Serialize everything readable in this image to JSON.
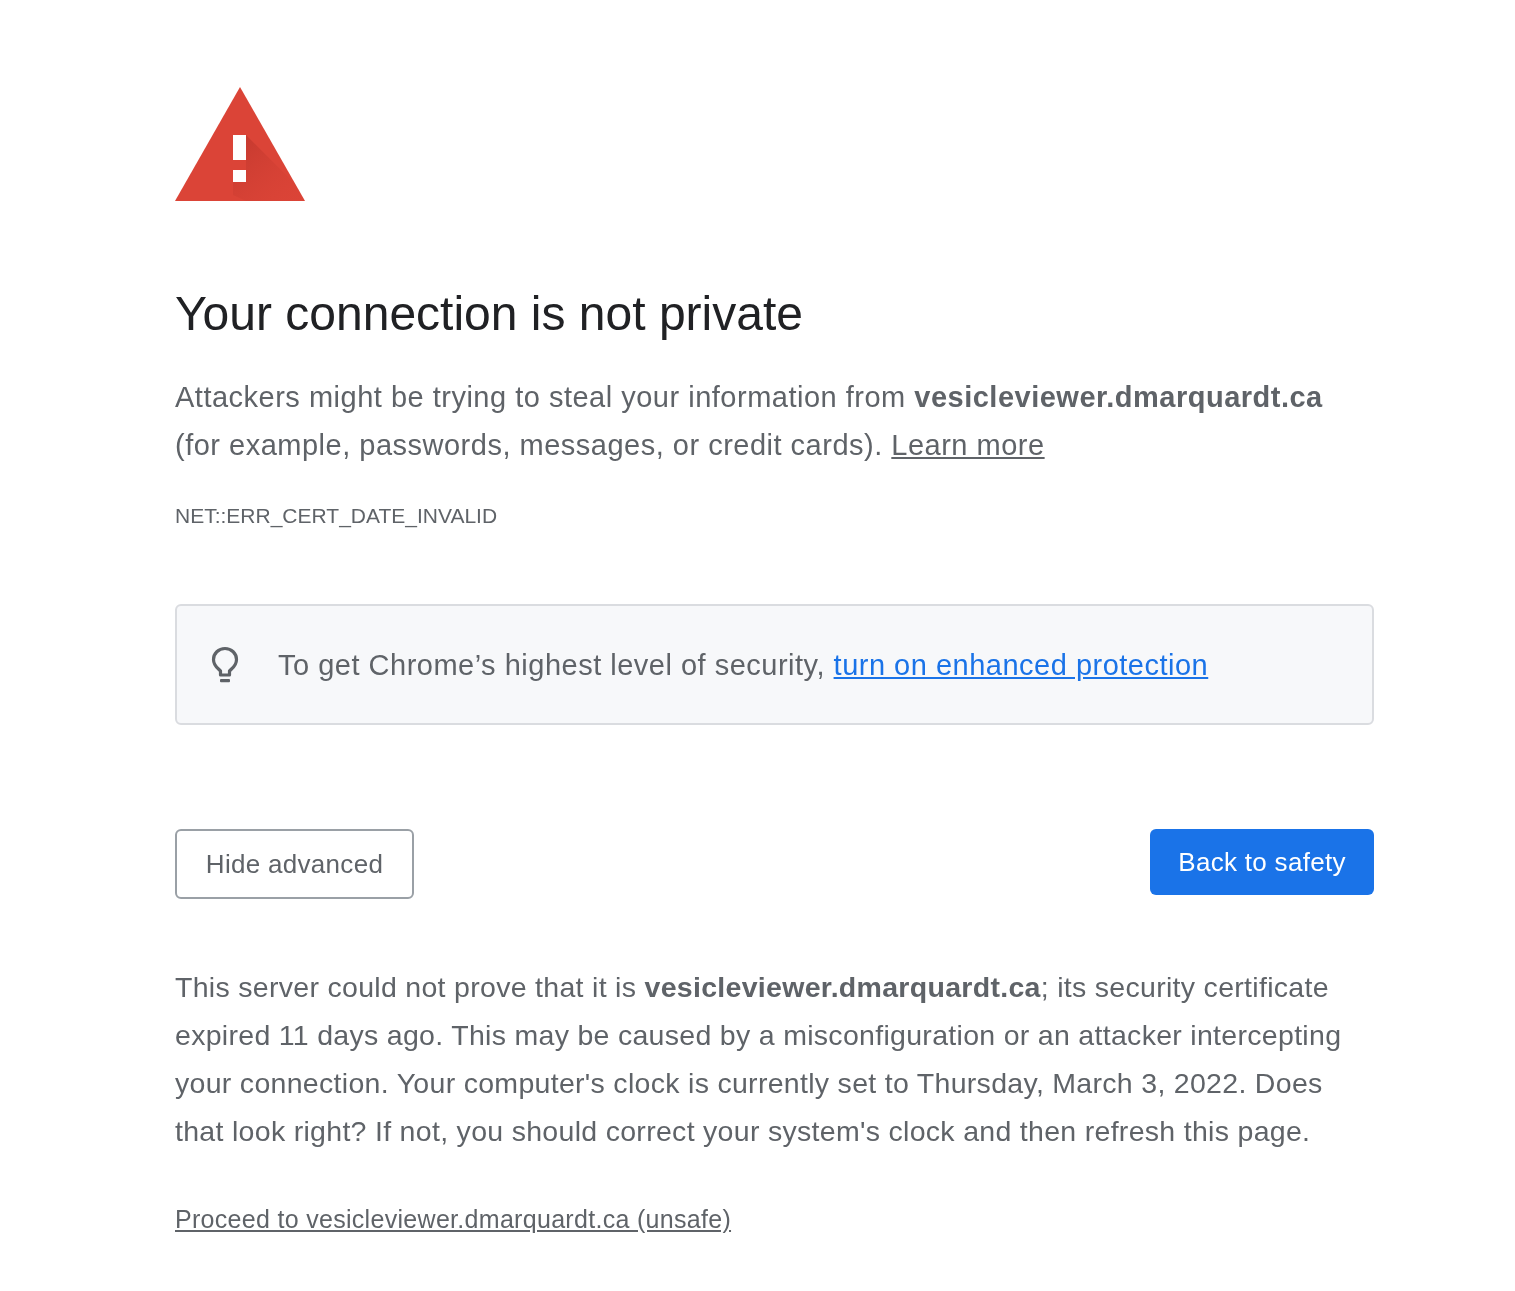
{
  "heading": "Your connection is not private",
  "message": {
    "text": "Attackers might be trying to steal your information from **vesicleviewer.dmarquardt.ca** (for example, passwords, messages, or credit cards).",
    "link": "Learn more"
  },
  "error_code": "NET::ERR_CERT_DATE_INVALID",
  "tip": {
    "text": "To get Chrome’s highest level of security,",
    "link": "turn on enhanced protection"
  },
  "buttons": [
    {
      "label": "Hide advanced",
      "kind": "secondary"
    },
    {
      "label": "Back to safety",
      "kind": "primary"
    }
  ],
  "details": "This server could not prove that it is **vesicleviewer.dmarquardt.ca**; its security certificate expired 11 days ago. This may be caused by a misconfiguration or an attacker intercepting your connection. Your computer's clock is currently set to Thursday, March 3, 2022. Does that look right? If not, you should correct your system's clock and then refresh this page.",
  "proceed_link": "Proceed to vesicleviewer.dmarquardt.ca (unsafe)"
}
